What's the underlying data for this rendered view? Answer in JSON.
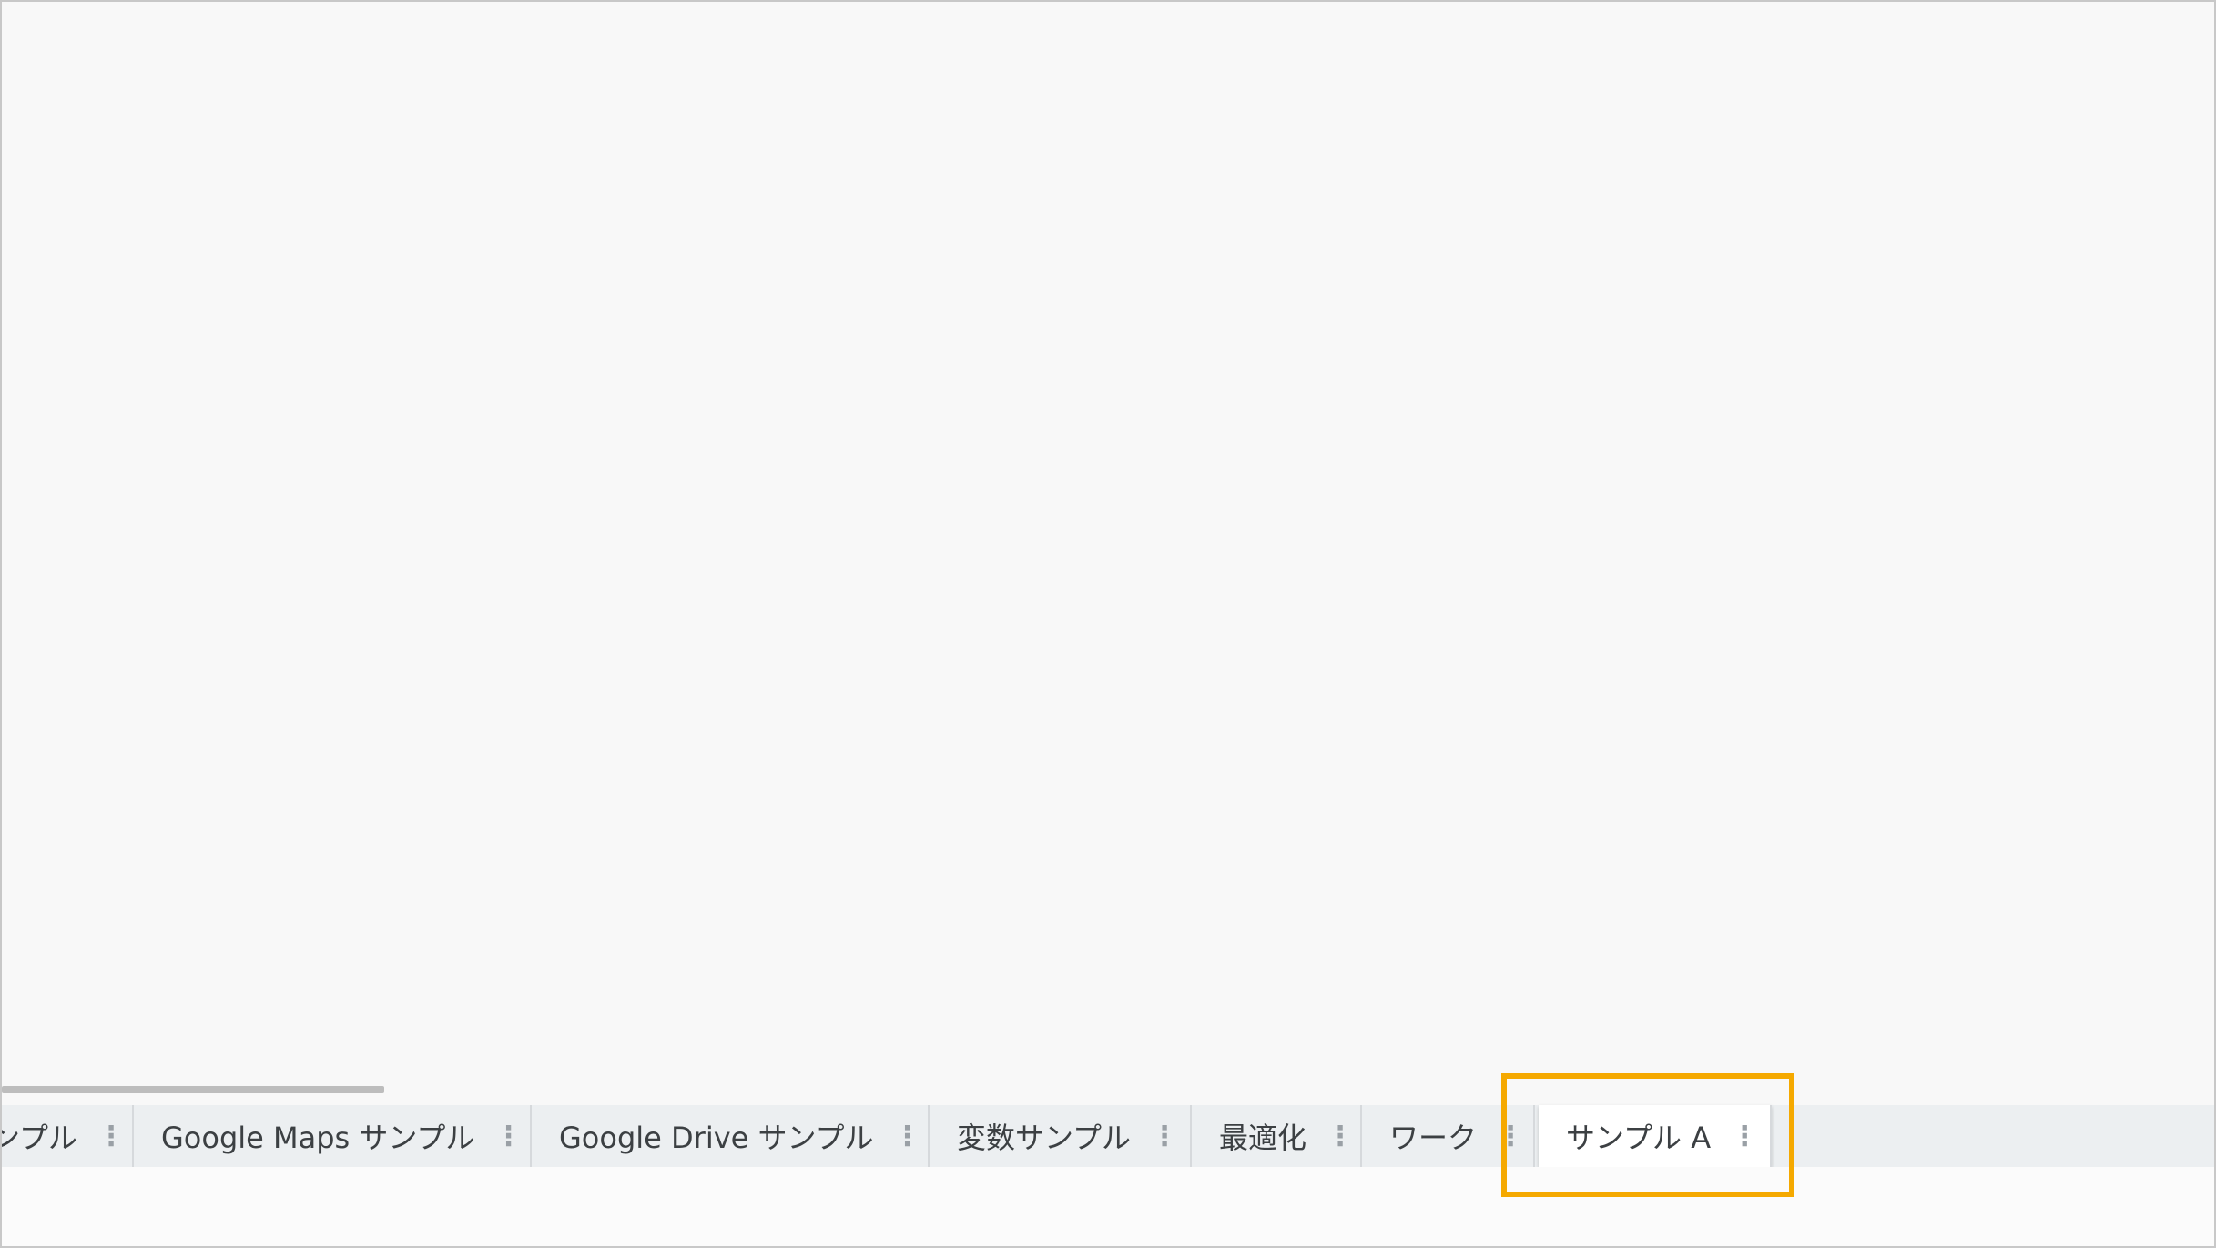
{
  "tabs": [
    {
      "label": "サンプル",
      "active": false,
      "clipped": true
    },
    {
      "label": "Google Maps サンプル",
      "active": false
    },
    {
      "label": "Google Drive サンプル",
      "active": false
    },
    {
      "label": "変数サンプル",
      "active": false
    },
    {
      "label": "最適化",
      "active": false
    },
    {
      "label": "ワーク",
      "active": false
    },
    {
      "label": "サンプル A",
      "active": true
    }
  ],
  "tab_menu_glyph": "⋮",
  "colors": {
    "highlight": "#f5a900",
    "tabbar": "#eceff1",
    "active_tab": "#ffffff"
  },
  "icons": {
    "tab_menu": "more-vert-icon"
  }
}
